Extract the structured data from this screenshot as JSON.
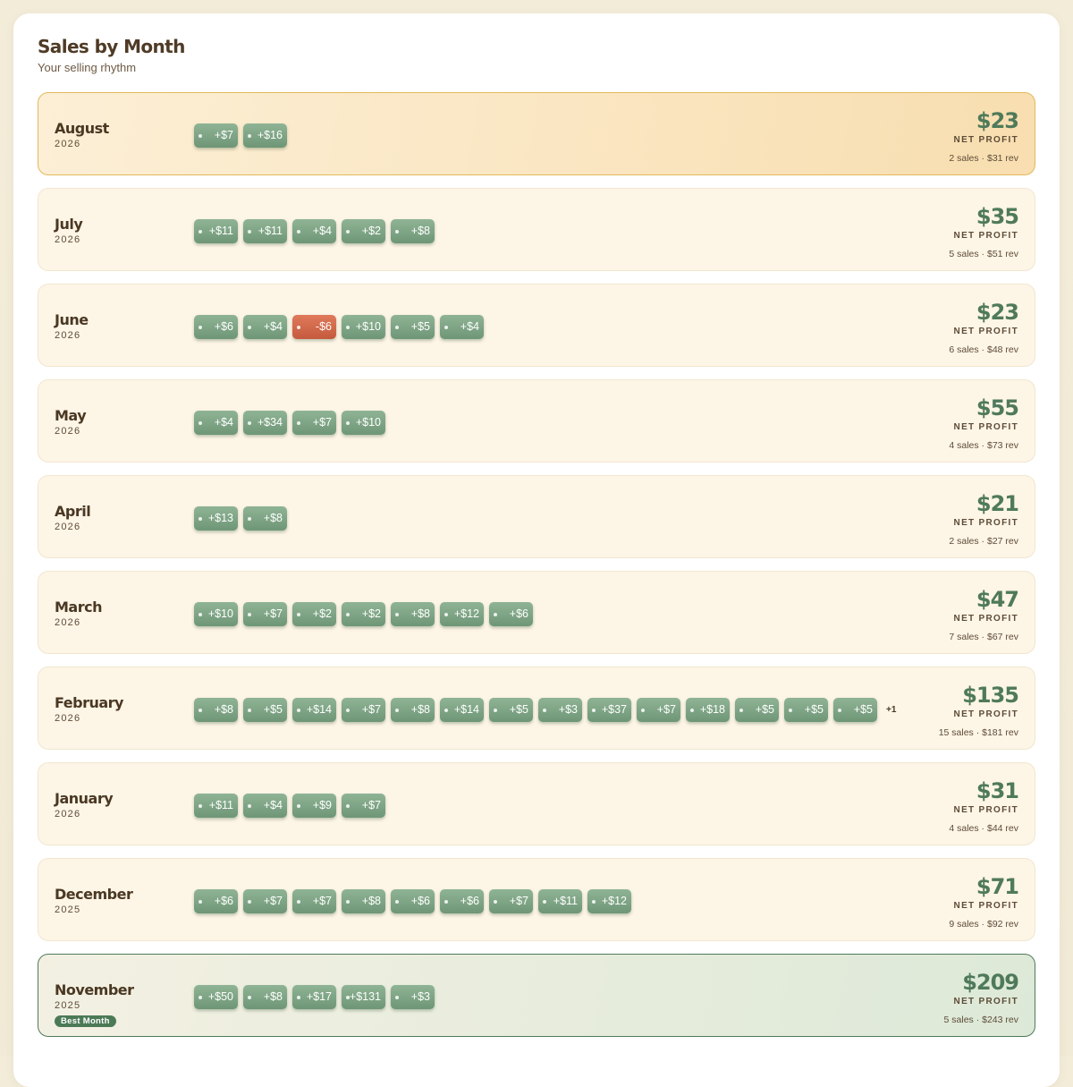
{
  "header": {
    "title": "Sales by Month",
    "subtitle": "Your selling rhythm"
  },
  "labels": {
    "net_profit": "NET PROFIT",
    "best_month": "Best Month"
  },
  "colors": {
    "positive": "#6e9676",
    "negative": "#c45a3d",
    "highlight_current": "#f8deb0",
    "highlight_best": "#dde9d8"
  },
  "months": [
    {
      "month": "August",
      "year": "2026",
      "net": "$23",
      "detail": "2 sales · $31 rev",
      "highlight": "current",
      "chips": [
        "+$7",
        "+$16"
      ]
    },
    {
      "month": "July",
      "year": "2026",
      "net": "$35",
      "detail": "5 sales · $51 rev",
      "chips": [
        "+$11",
        "+$11",
        "+$4",
        "+$2",
        "+$8"
      ]
    },
    {
      "month": "June",
      "year": "2026",
      "net": "$23",
      "detail": "6 sales · $48 rev",
      "chips": [
        "+$6",
        "+$4",
        "-$6",
        "+$10",
        "+$5",
        "+$4"
      ]
    },
    {
      "month": "May",
      "year": "2026",
      "net": "$55",
      "detail": "4 sales · $73 rev",
      "chips": [
        "+$4",
        "+$34",
        "+$7",
        "+$10"
      ]
    },
    {
      "month": "April",
      "year": "2026",
      "net": "$21",
      "detail": "2 sales · $27 rev",
      "chips": [
        "+$13",
        "+$8"
      ]
    },
    {
      "month": "March",
      "year": "2026",
      "net": "$47",
      "detail": "7 sales · $67 rev",
      "chips": [
        "+$10",
        "+$7",
        "+$2",
        "+$2",
        "+$8",
        "+$12",
        "+$6"
      ]
    },
    {
      "month": "February",
      "year": "2026",
      "net": "$135",
      "detail": "15 sales · $181 rev",
      "chips": [
        "+$8",
        "+$5",
        "+$14",
        "+$7",
        "+$8",
        "+$14",
        "+$5",
        "+$3",
        "+$37",
        "+$7",
        "+$18",
        "+$5",
        "+$5",
        "+$5"
      ],
      "more": "+1"
    },
    {
      "month": "January",
      "year": "2026",
      "net": "$31",
      "detail": "4 sales · $44 rev",
      "chips": [
        "+$11",
        "+$4",
        "+$9",
        "+$7"
      ]
    },
    {
      "month": "December",
      "year": "2025",
      "net": "$71",
      "detail": "9 sales · $92 rev",
      "chips": [
        "+$6",
        "+$7",
        "+$7",
        "+$8",
        "+$6",
        "+$6",
        "+$7",
        "+$11",
        "+$12"
      ]
    },
    {
      "month": "November",
      "year": "2025",
      "net": "$209",
      "detail": "5 sales · $243 rev",
      "highlight": "best",
      "chips": [
        "+$50",
        "+$8",
        "+$17",
        "+$131",
        "+$3"
      ]
    }
  ]
}
